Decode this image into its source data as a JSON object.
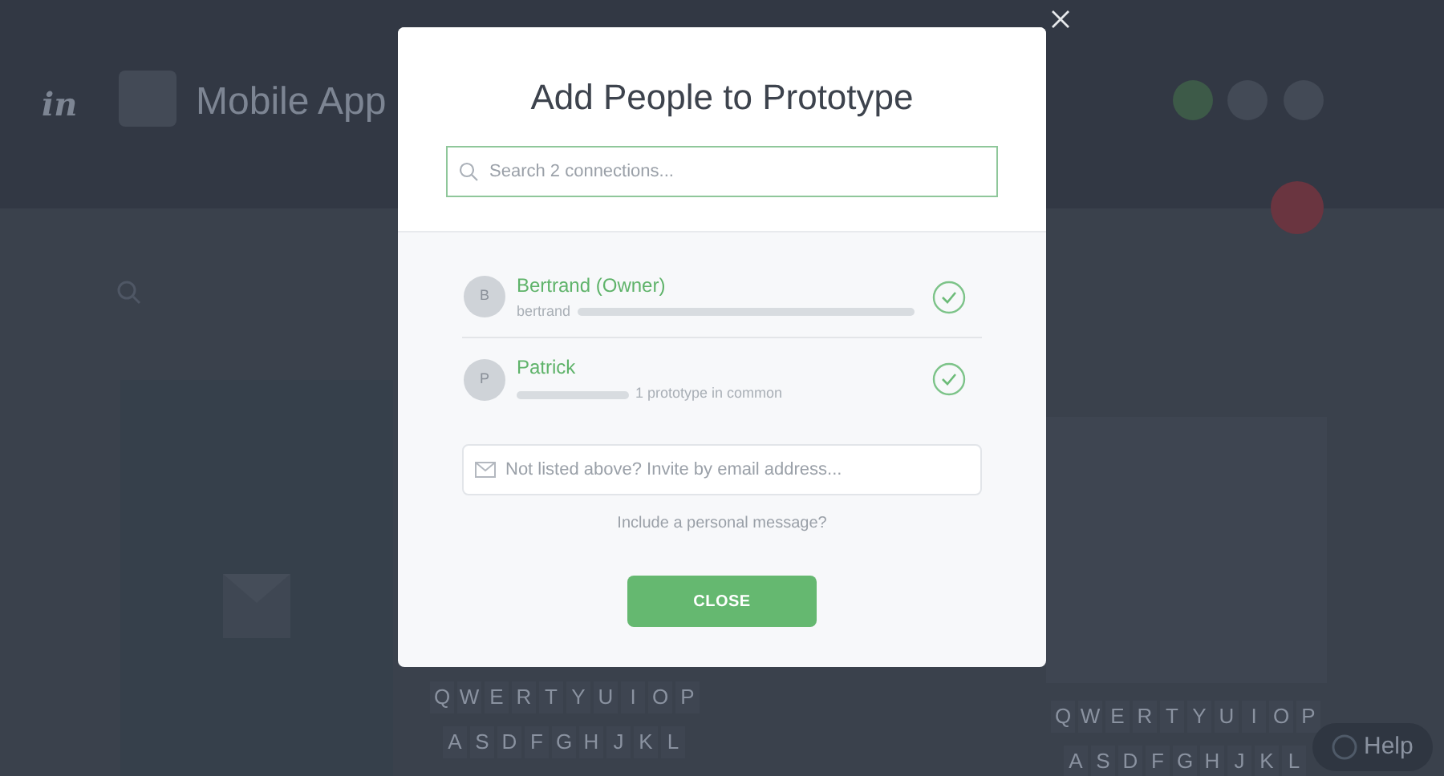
{
  "background": {
    "logo": "in",
    "app_title": "Mobile App",
    "keyboards": [
      {
        "rows": [
          [
            "Q",
            "W",
            "E",
            "R",
            "T",
            "Y",
            "U",
            "I",
            "O",
            "P"
          ],
          [
            "A",
            "S",
            "D",
            "F",
            "G",
            "H",
            "J",
            "K",
            "L"
          ]
        ]
      },
      {
        "rows": [
          [
            "Q",
            "W",
            "E",
            "R",
            "T",
            "Y",
            "U",
            "I",
            "O",
            "P"
          ],
          [
            "A",
            "S",
            "D",
            "F",
            "G",
            "H",
            "J",
            "K",
            "L"
          ]
        ]
      }
    ],
    "help_button": "Help"
  },
  "dialog": {
    "title": "Add People to Prototype",
    "search": {
      "placeholder": "Search 2 connections..."
    },
    "people": [
      {
        "initial": "B",
        "name": "Bertrand (Owner)",
        "detail": "bertrand",
        "kind": "email",
        "selected": true
      },
      {
        "initial": "P",
        "name": "Patrick",
        "detail": "1 prototype in common",
        "kind": "shared",
        "selected": true
      }
    ],
    "invite": {
      "placeholder": "Not listed above? Invite by email address..."
    },
    "message_link": "Include a personal message?",
    "close_button": "CLOSE"
  }
}
